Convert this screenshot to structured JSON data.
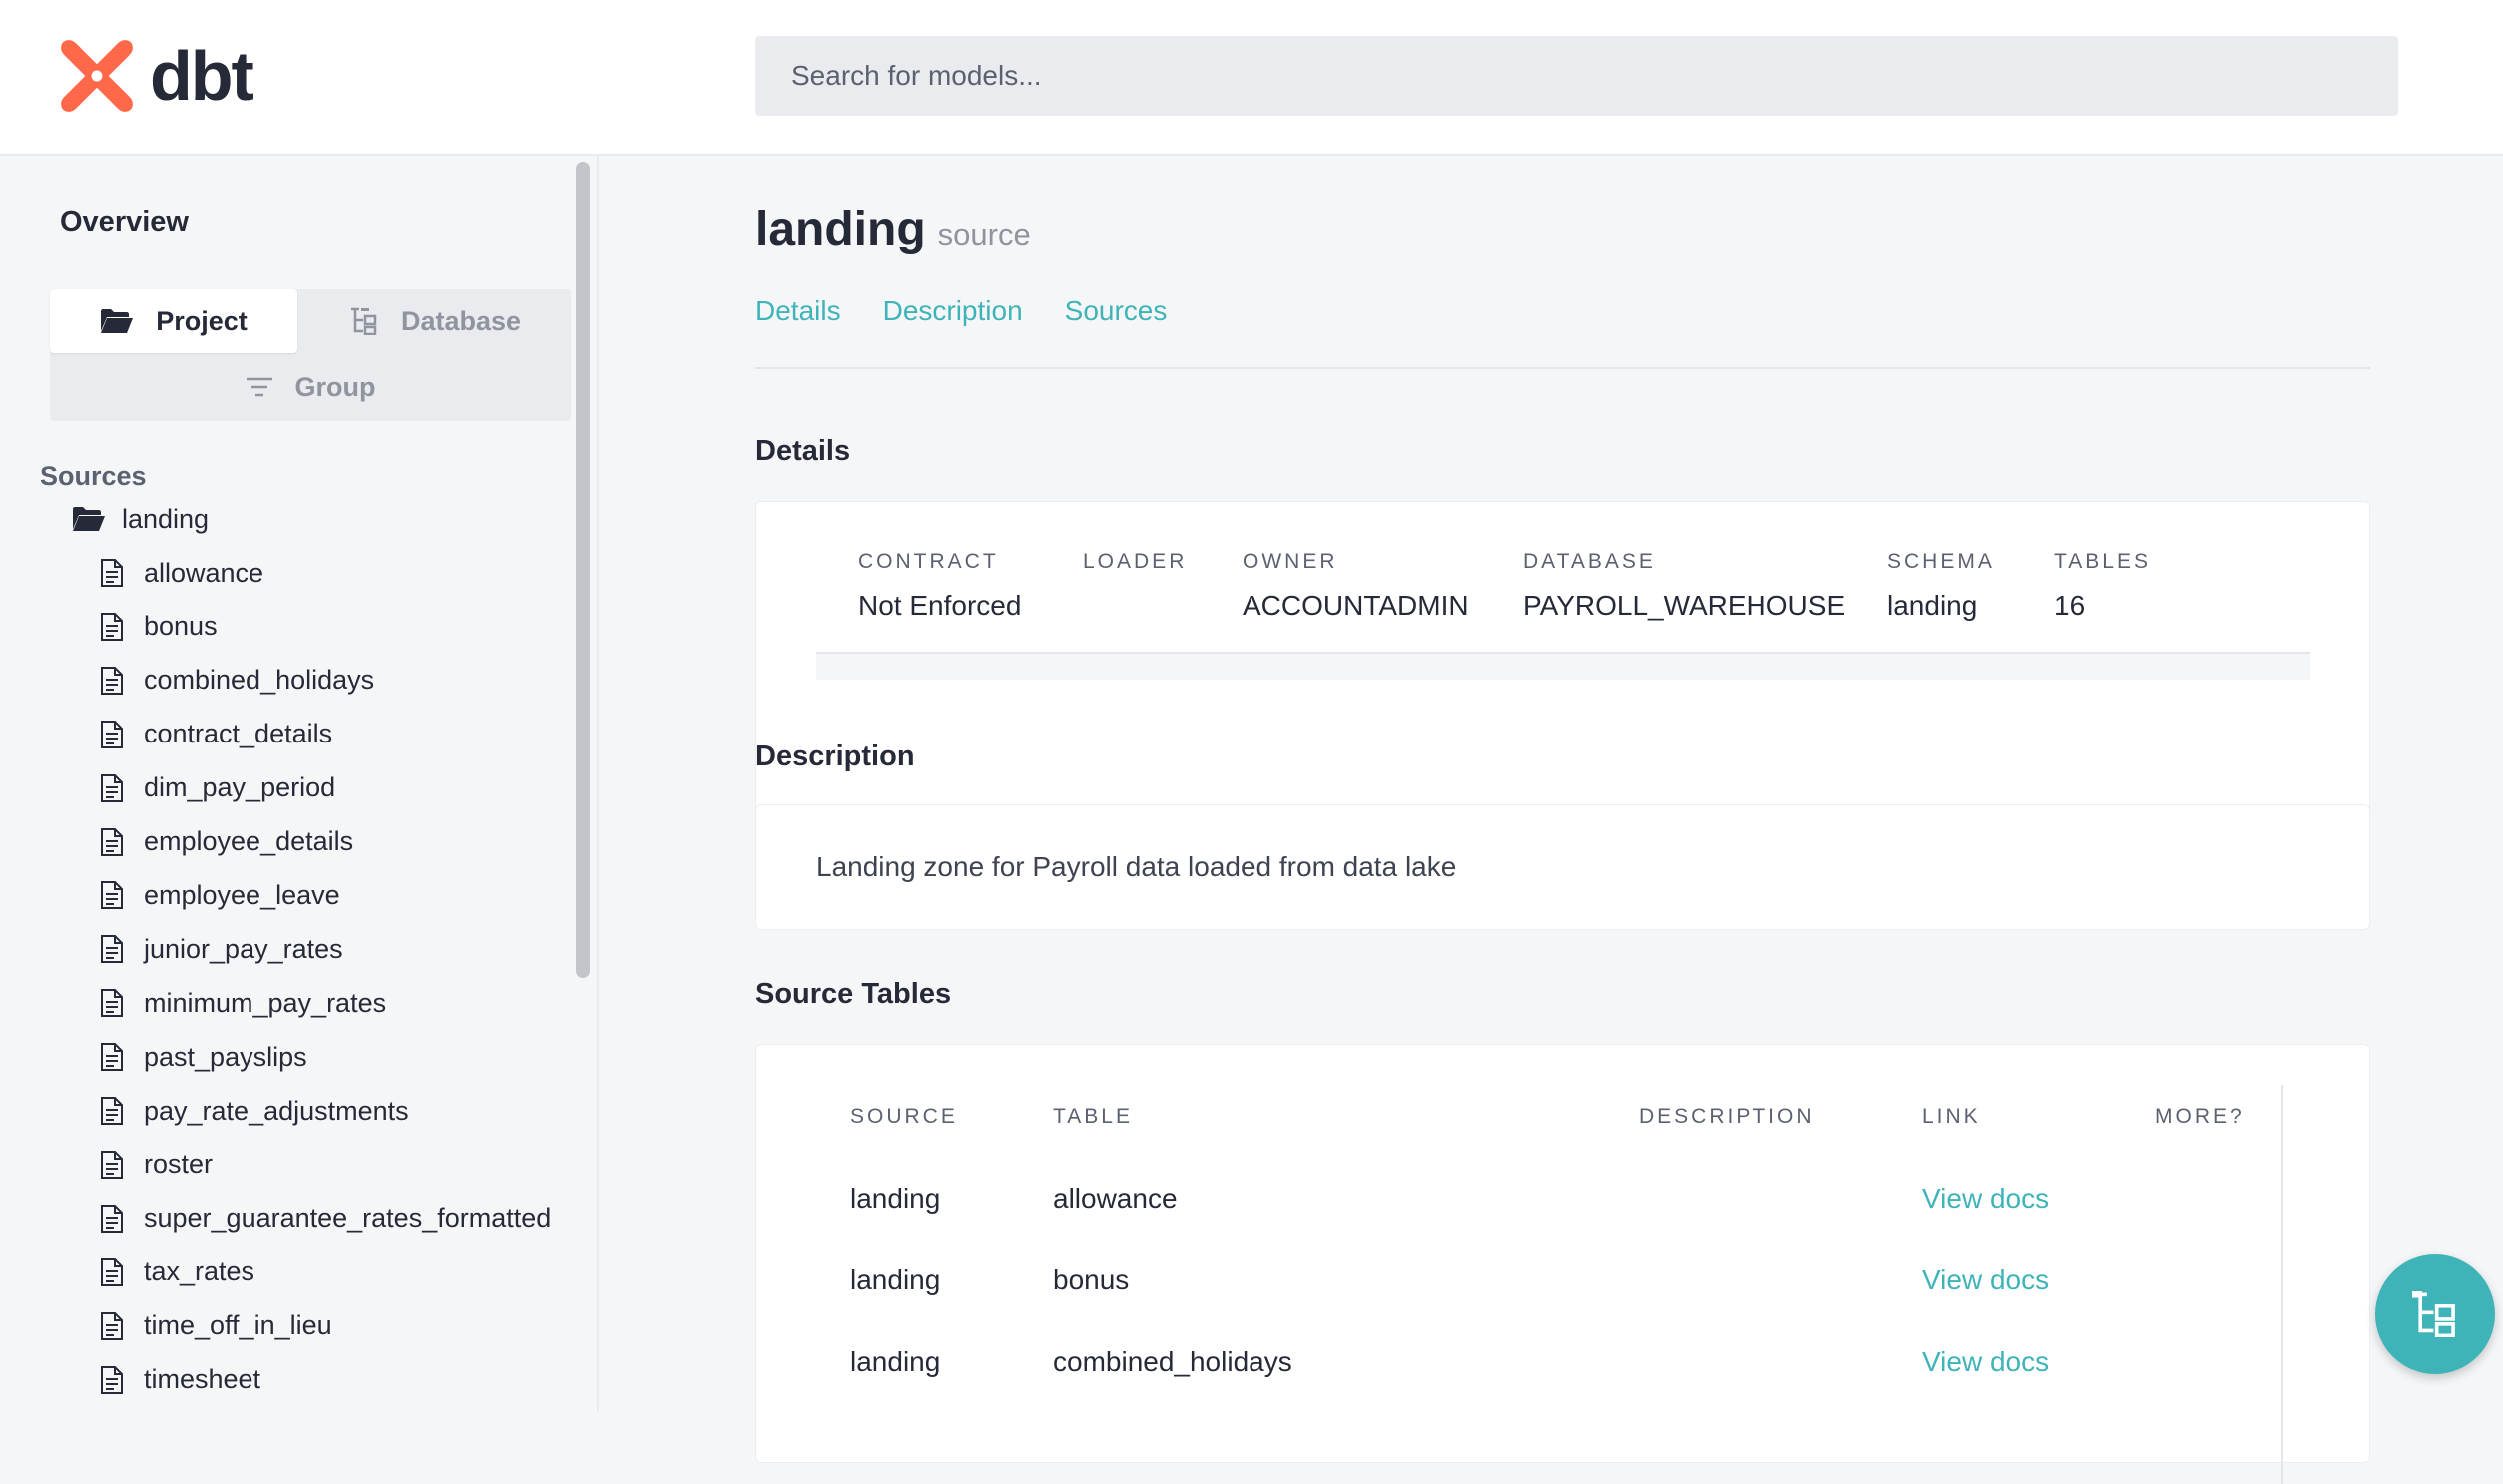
{
  "header": {
    "logo_text": "dbt",
    "search": {
      "placeholder": "Search for models..."
    }
  },
  "sidebar": {
    "overview": "Overview",
    "tabs": {
      "project": "Project",
      "database": "Database",
      "group": "Group"
    },
    "sources_heading": "Sources",
    "folder": "landing",
    "items": [
      "allowance",
      "bonus",
      "combined_holidays",
      "contract_details",
      "dim_pay_period",
      "employee_details",
      "employee_leave",
      "junior_pay_rates",
      "minimum_pay_rates",
      "past_payslips",
      "pay_rate_adjustments",
      "roster",
      "super_guarantee_rates_formatted",
      "tax_rates",
      "time_off_in_lieu",
      "timesheet"
    ]
  },
  "main": {
    "title": "landing",
    "subtitle": "source",
    "nav": [
      "Details",
      "Description",
      "Sources"
    ],
    "details": {
      "heading": "Details",
      "fields": [
        {
          "label": "CONTRACT",
          "value": "Not Enforced"
        },
        {
          "label": "LOADER",
          "value": ""
        },
        {
          "label": "OWNER",
          "value": "ACCOUNTADMIN"
        },
        {
          "label": "DATABASE",
          "value": "PAYROLL_WAREHOUSE"
        },
        {
          "label": "SCHEMA",
          "value": "landing"
        },
        {
          "label": "TABLES",
          "value": "16"
        }
      ]
    },
    "description": {
      "heading": "Description",
      "text": "Landing zone for Payroll data loaded from data lake"
    },
    "source_tables": {
      "heading": "Source Tables",
      "columns": [
        "SOURCE",
        "TABLE",
        "DESCRIPTION",
        "LINK",
        "MORE?"
      ],
      "rows": [
        {
          "source": "landing",
          "table": "allowance",
          "description": "",
          "link": "View docs"
        },
        {
          "source": "landing",
          "table": "bonus",
          "description": "",
          "link": "View docs"
        },
        {
          "source": "landing",
          "table": "combined_holidays",
          "description": "",
          "link": "View docs"
        }
      ]
    }
  },
  "colors": {
    "accent": "#3fb4b8",
    "brand_orange": "#ff694a",
    "text": "#262a38",
    "muted": "#8f949e",
    "background": "#f5f6f7"
  },
  "icons": {
    "logo": "dbt-logo-icon",
    "project_tab": "folder-open-icon",
    "database_tab": "tree-icon",
    "group_tab": "filter-icon",
    "folder": "folder-open-icon",
    "item": "document-icon",
    "fab": "lineage-graph-icon"
  }
}
